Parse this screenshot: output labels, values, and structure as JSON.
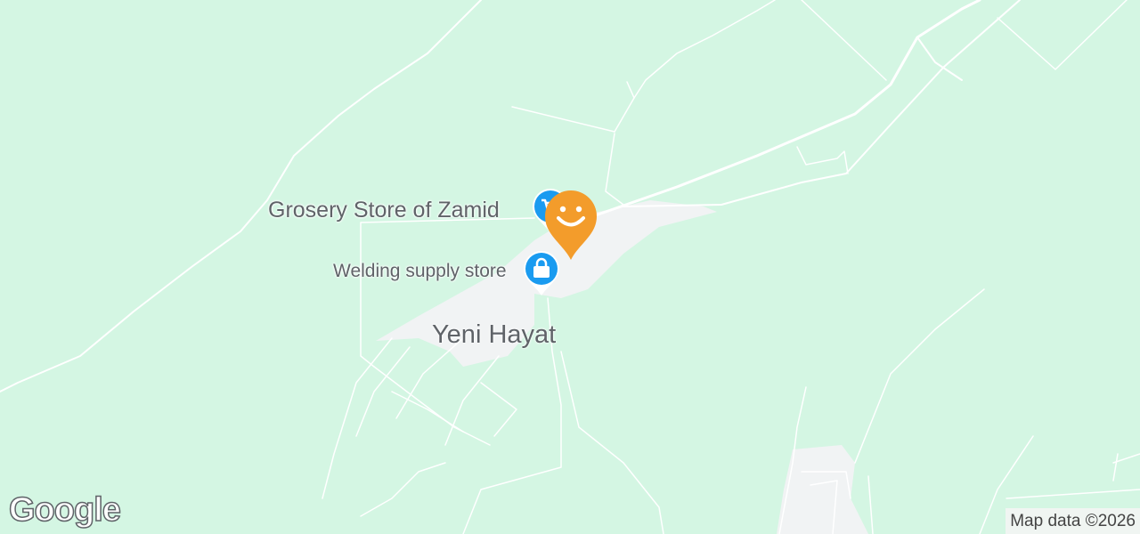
{
  "map": {
    "background_color": "#d4f6e3",
    "road_color": "#ffffff",
    "urban_color": "#f1f3f4",
    "pois": [
      {
        "label": "Grosery Store of Zamid",
        "icon": "shopping-cart-icon",
        "color": "#1a9bf0"
      },
      {
        "label": "Welding supply store",
        "icon": "shopping-bag-icon",
        "color": "#1a9bf0"
      }
    ],
    "town": "Yeni Hayat",
    "user_marker": {
      "icon": "smiley-icon",
      "color": "#f39c2b"
    }
  },
  "branding": {
    "logo": "Google"
  },
  "attribution": "Map data ©2026"
}
